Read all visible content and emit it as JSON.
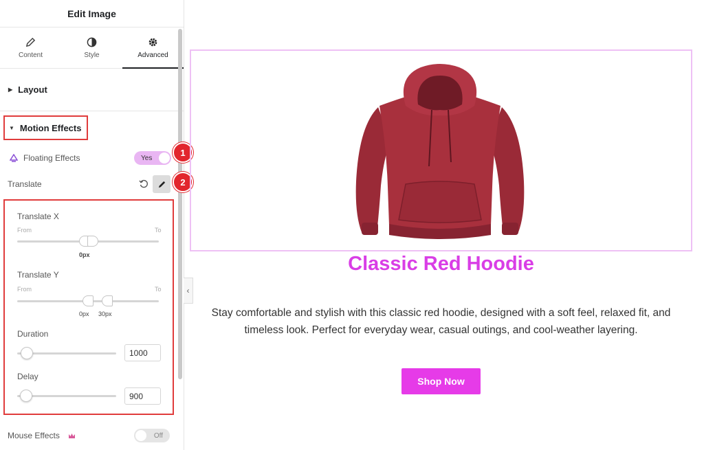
{
  "panel": {
    "title": "Edit Image",
    "tabs": [
      {
        "label": "Content",
        "icon": "pencil-icon"
      },
      {
        "label": "Style",
        "icon": "half-circle-icon"
      },
      {
        "label": "Advanced",
        "icon": "gear-icon",
        "active": true
      }
    ],
    "sections": {
      "layout": "Layout",
      "motion_effects": "Motion Effects"
    },
    "floating_effects": {
      "label": "Floating Effects",
      "toggle": "Yes"
    },
    "translate": {
      "label": "Translate"
    },
    "popover": {
      "translate_x": {
        "label": "Translate X",
        "from": "From",
        "to": "To",
        "value": "0px"
      },
      "translate_y": {
        "label": "Translate Y",
        "from": "From",
        "to": "To",
        "value_from": "0px",
        "value_to": "30px"
      },
      "duration": {
        "label": "Duration",
        "value": "1000"
      },
      "delay": {
        "label": "Delay",
        "value": "900"
      }
    },
    "mouse_effects": {
      "label": "Mouse Effects",
      "toggle": "Off"
    },
    "callouts": [
      "1",
      "2"
    ]
  },
  "canvas": {
    "product_title": "Classic Red Hoodie",
    "description": "Stay comfortable and stylish with this classic red hoodie, designed with a soft feel, relaxed fit, and timeless look. Perfect for everyday wear, casual outings, and cool-weather layering.",
    "button": "Shop Now"
  },
  "colors": {
    "accent": "#d93ee6",
    "button": "#e63be8",
    "highlight": "#e03b3b",
    "hoodie": "#a8303d"
  }
}
